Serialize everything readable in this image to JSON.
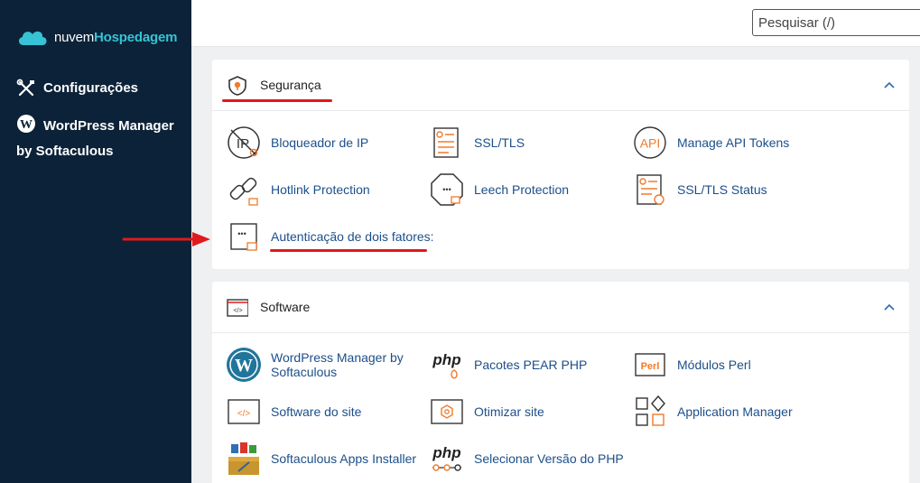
{
  "brand": {
    "part1": "nuvem",
    "part2": "Hospedagem"
  },
  "sidebar": {
    "items": [
      {
        "label": "Configurações"
      },
      {
        "label": "WordPress Manager by Softaculous"
      }
    ]
  },
  "search": {
    "placeholder": "Pesquisar (/)"
  },
  "security": {
    "title": "Segurança",
    "items": [
      {
        "label": "Bloqueador de IP"
      },
      {
        "label": "SSL/TLS"
      },
      {
        "label": "Manage API Tokens"
      },
      {
        "label": "Hotlink Protection"
      },
      {
        "label": "Leech Protection"
      },
      {
        "label": "SSL/TLS Status"
      },
      {
        "label": "Autenticação de dois fatores:"
      }
    ]
  },
  "software": {
    "title": "Software",
    "items": [
      {
        "label": "WordPress Manager by Softaculous"
      },
      {
        "label": "Pacotes PEAR PHP"
      },
      {
        "label": "Módulos Perl"
      },
      {
        "label": "Software do site"
      },
      {
        "label": "Otimizar site"
      },
      {
        "label": "Application Manager"
      },
      {
        "label": "Softaculous Apps Installer"
      },
      {
        "label": "Selecionar Versão do PHP"
      }
    ]
  },
  "icon_text": {
    "ip": "IP",
    "api": "API",
    "php": "php",
    "perl": "Perl",
    "code": "</>",
    "dots": "•••"
  },
  "colors": {
    "sidebar": "#0c2238",
    "accent": "#f07b2a",
    "link": "#1c4f8a",
    "annotation": "#e0191c",
    "brand_highlight": "#36c3d6"
  }
}
